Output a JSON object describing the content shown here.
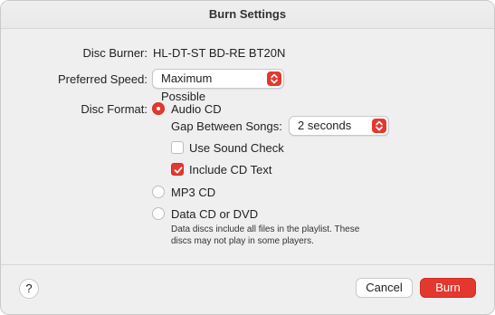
{
  "window": {
    "title": "Burn Settings"
  },
  "disc_burner": {
    "label": "Disc Burner:",
    "value": "HL-DT-ST BD-RE BT20N"
  },
  "preferred_speed": {
    "label": "Preferred Speed:",
    "value": "Maximum Possible"
  },
  "disc_format": {
    "label": "Disc Format:",
    "options": {
      "audio_cd": {
        "label": "Audio CD",
        "selected": true
      },
      "mp3_cd": {
        "label": "MP3 CD",
        "selected": false
      },
      "data_cd_dvd": {
        "label": "Data CD or DVD",
        "selected": false
      }
    },
    "gap_between_songs": {
      "label": "Gap Between Songs:",
      "value": "2 seconds"
    },
    "use_sound_check": {
      "label": "Use Sound Check",
      "checked": false
    },
    "include_cd_text": {
      "label": "Include CD Text",
      "checked": true
    },
    "data_note_line1": "Data discs include all files in the playlist. These",
    "data_note_line2": "discs may not play in some players."
  },
  "footer": {
    "help": "?",
    "cancel": "Cancel",
    "burn": "Burn"
  },
  "colors": {
    "accent": "#e3382f"
  }
}
